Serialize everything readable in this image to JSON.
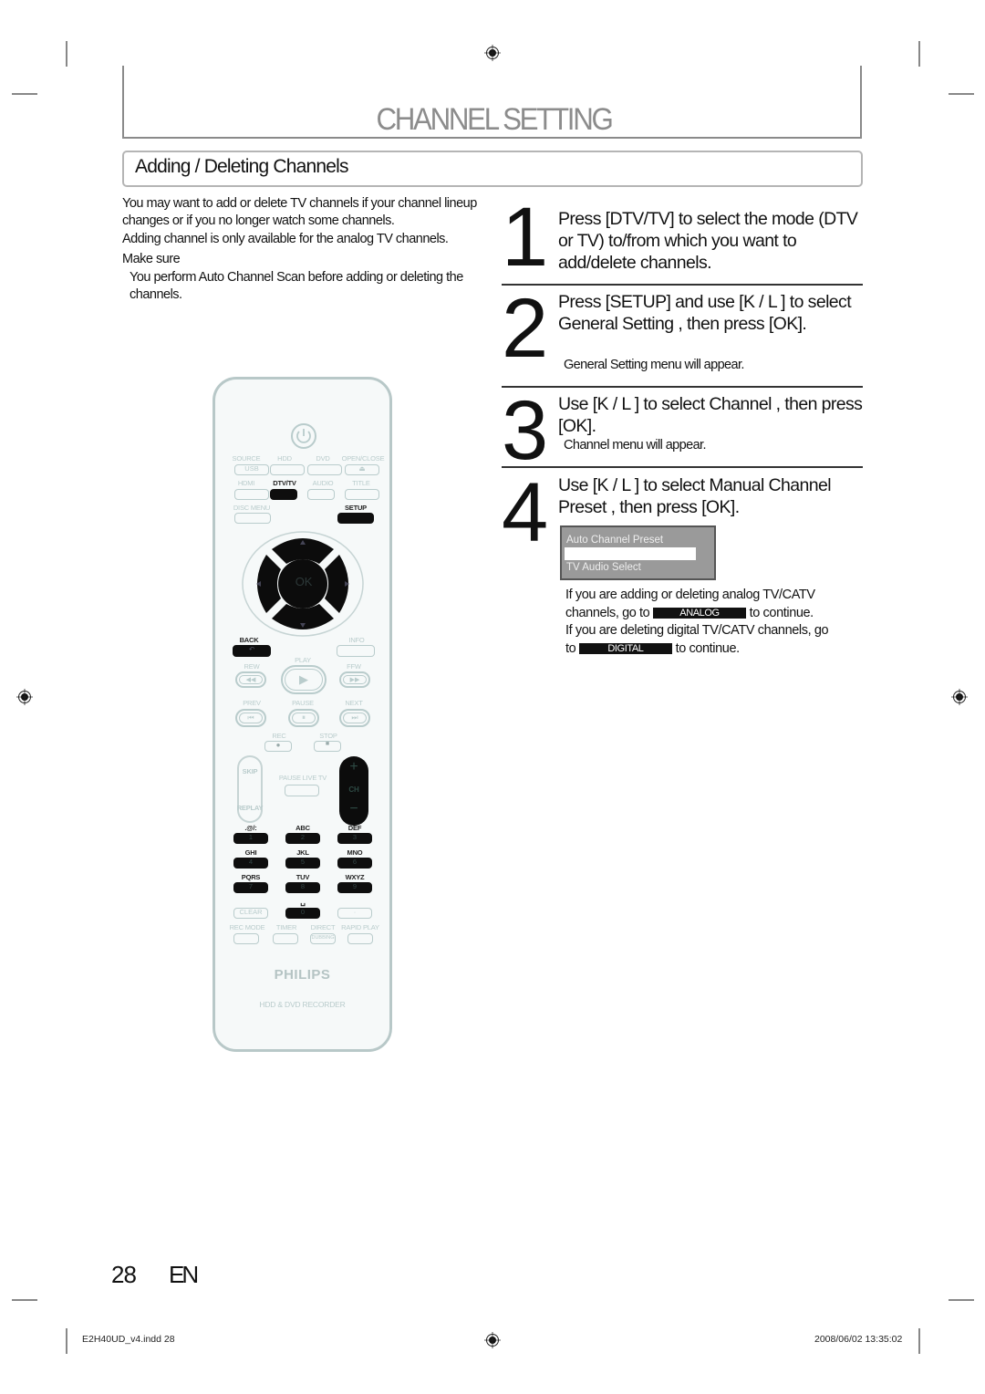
{
  "header": {
    "title": "CHANNEL SETTING",
    "section_title": "Adding / Deleting Channels"
  },
  "intro": {
    "paragraphs": [
      "You may want to add or delete TV channels if your channel lineup changes or if you no longer watch some channels.",
      "Adding channel is only available for the analog TV channels."
    ],
    "make_sure_label": "Make sure",
    "make_sure_text": "You perform  Auto Channel Scan  before adding or deleting the channels."
  },
  "steps": [
    {
      "number": "1",
      "text": "Press [DTV/TV] to select the mode (DTV or TV) to/from which you want to add/delete channels.",
      "note": ""
    },
    {
      "number": "2",
      "text": "Press [SETUP] and use [K / L ] to select  General Setting , then press [OK].",
      "note": "General Setting  menu will appear."
    },
    {
      "number": "3",
      "text": "Use [K / L ] to select  Channel , then press [OK].",
      "note": "Channel  menu will appear."
    },
    {
      "number": "4",
      "text": "Use [K / L ] to select  Manual Channel Preset , then press [OK].",
      "note": ""
    }
  ],
  "menu_screen": {
    "items": [
      "Auto Channel Preset",
      "",
      "TV Audio Select"
    ],
    "highlighted_index": 1
  },
  "after_notes": {
    "analog_line1": "If you are adding or deleting analog TV/CATV",
    "analog_line2_pre": "channels, go to",
    "analog_tag": "ANALOG",
    "analog_line2_post": "to continue.",
    "digital_line1": "If you are deleting digital TV/CATV channels, go",
    "digital_line2_pre": "to",
    "digital_tag": "DIGITAL",
    "digital_line2_post": "to continue."
  },
  "remote": {
    "row1_labels": [
      "SOURCE",
      "HDD",
      "DVD",
      "OPEN/CLOSE"
    ],
    "row1_glyphs": [
      "USB",
      "",
      "",
      "⏏"
    ],
    "row2_labels": [
      "HDMI",
      "DTV/TV",
      "AUDIO",
      "TITLE"
    ],
    "row3_labels": [
      "DISC MENU",
      "SETUP"
    ],
    "ok_label": "OK",
    "back_label": "BACK",
    "back_glyph": "↶",
    "info_label": "INFO",
    "transport_labels": [
      "REW",
      "PLAY",
      "FFW"
    ],
    "transport_glyphs": [
      "◀◀",
      "▶",
      "▶▶"
    ],
    "skip_labels": [
      "PREV",
      "PAUSE",
      "NEXT"
    ],
    "skip_glyphs": [
      "⏮",
      "⏸",
      "⏭"
    ],
    "rec_labels": [
      "REC",
      "STOP"
    ],
    "skip_label": "SKIP",
    "replay_label": "REPLAY",
    "pause_live_label": "PAUSE LIVE TV",
    "ch_label": "CH",
    "ch_plus": "+",
    "ch_minus": "−",
    "keypad": [
      {
        "letters": ".@/:",
        "digit": "1"
      },
      {
        "letters": "ABC",
        "digit": "2"
      },
      {
        "letters": "DEF",
        "digit": "3"
      },
      {
        "letters": "GHI",
        "digit": "4"
      },
      {
        "letters": "JKL",
        "digit": "5"
      },
      {
        "letters": "MNO",
        "digit": "6"
      },
      {
        "letters": "PQRS",
        "digit": "7"
      },
      {
        "letters": "TUV",
        "digit": "8"
      },
      {
        "letters": "WXYZ",
        "digit": "9"
      }
    ],
    "clear_label": "CLEAR",
    "zero_digit": "0",
    "space_glyph": "␣",
    "dot_glyph": "·",
    "bottom_labels": [
      "REC MODE",
      "TIMER",
      "DIRECT",
      "RAPID PLAY"
    ],
    "dubbing_label": "DUBBING",
    "brand": "PHILIPS",
    "model_desc": "HDD & DVD RECORDER"
  },
  "footer": {
    "page_number": "28",
    "language": "EN",
    "slug_file": "E2H40UD_v4.indd   28",
    "slug_date": "2008/06/02   13:35:02"
  }
}
